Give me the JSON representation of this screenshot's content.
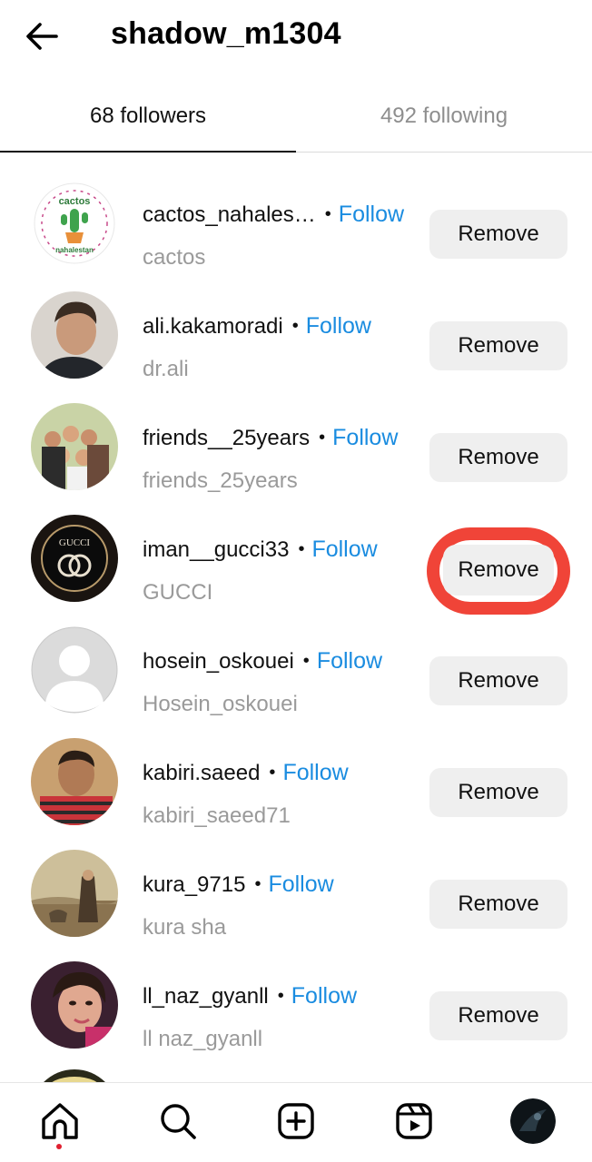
{
  "header": {
    "title": "shadow_m1304",
    "back_icon": "arrow-left-icon"
  },
  "tabs": {
    "followers": "68 followers",
    "following": "492 following"
  },
  "colors": {
    "follow_blue": "#1a8ce0",
    "highlight_red": "#f04438",
    "button_bg": "#efefef",
    "secondary_text": "#9a9a9a"
  },
  "followers": [
    {
      "username": "cactos_nahales…",
      "name": "cactos",
      "follow": "Follow",
      "action": "Remove"
    },
    {
      "username": "ali.kakamoradi",
      "name": "dr.ali",
      "follow": "Follow",
      "action": "Remove"
    },
    {
      "username": "friends__25years",
      "name": "friends_25years",
      "follow": "Follow",
      "action": "Remove"
    },
    {
      "username": "iman__gucci33",
      "name": "GUCCI",
      "follow": "Follow",
      "action": "Remove",
      "highlighted": true
    },
    {
      "username": "hosein_oskouei",
      "name": "Hosein_oskouei",
      "follow": "Follow",
      "action": "Remove"
    },
    {
      "username": "kabiri.saeed",
      "name": "kabiri_saeed71",
      "follow": "Follow",
      "action": "Remove"
    },
    {
      "username": "kura_9715",
      "name": "kura sha",
      "follow": "Follow",
      "action": "Remove"
    },
    {
      "username": "ll_naz_gyanll",
      "name": "ll naz_gyanll",
      "follow": "Follow",
      "action": "Remove"
    }
  ],
  "avatar_logo_text": {
    "cactos_top": "cactos",
    "cactos_bottom": "nahalestan",
    "gucci": "GUCCI"
  },
  "bottom_nav": [
    "home-icon",
    "search-icon",
    "create-icon",
    "reels-icon",
    "profile-avatar"
  ]
}
